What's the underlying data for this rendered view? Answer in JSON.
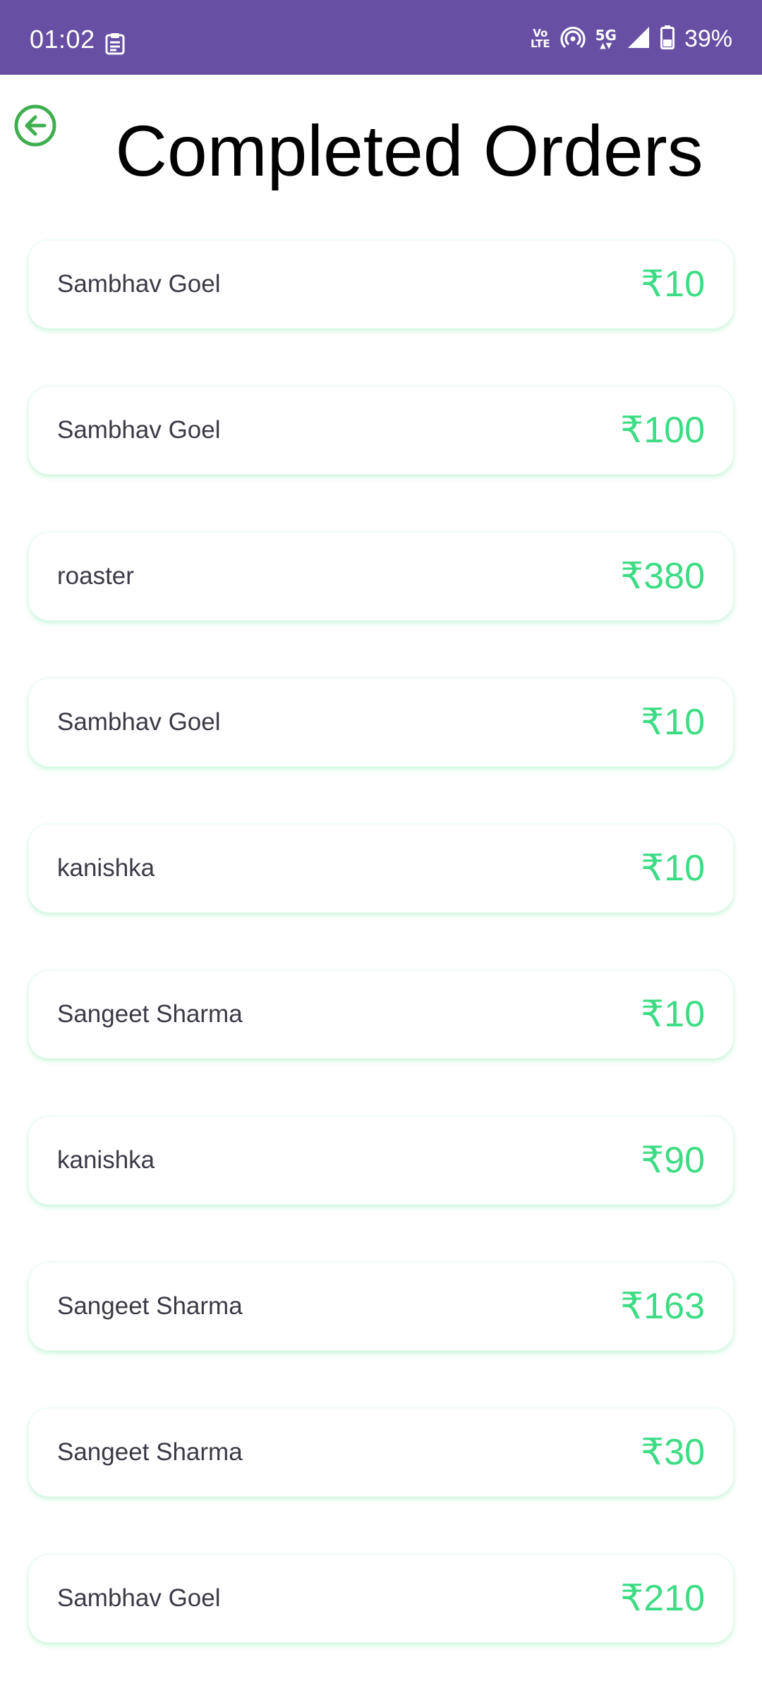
{
  "status_bar": {
    "time": "01:02",
    "volte_line1": "Vo",
    "volte_line2": "LTE",
    "network": "5G",
    "battery": "39%"
  },
  "header": {
    "title": "Completed Orders"
  },
  "orders": [
    {
      "name": "Sambhav Goel",
      "amount": "₹10"
    },
    {
      "name": "Sambhav Goel",
      "amount": "₹100"
    },
    {
      "name": "roaster",
      "amount": "₹380"
    },
    {
      "name": "Sambhav Goel",
      "amount": "₹10"
    },
    {
      "name": "kanishka",
      "amount": "₹10"
    },
    {
      "name": "Sangeet Sharma",
      "amount": "₹10"
    },
    {
      "name": "kanishka",
      "amount": "₹90"
    },
    {
      "name": "Sangeet Sharma",
      "amount": "₹163"
    },
    {
      "name": "Sangeet Sharma",
      "amount": "₹30"
    },
    {
      "name": "Sambhav Goel",
      "amount": "₹210"
    }
  ],
  "colors": {
    "status_bar": "#6750a4",
    "amount": "#3ddc84",
    "back_icon": "#3fae4f"
  },
  "icons": {
    "back": "back-arrow-circle-icon",
    "clipboard": "clipboard-icon",
    "hotspot": "hotspot-icon",
    "signal": "signal-icon",
    "battery": "battery-icon"
  }
}
